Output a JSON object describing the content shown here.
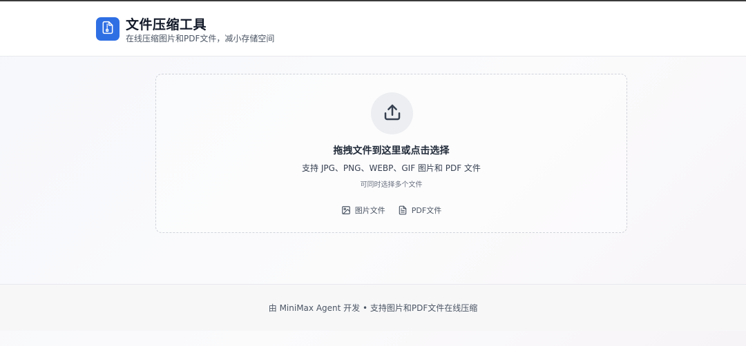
{
  "header": {
    "title": "文件压缩工具",
    "subtitle": "在线压缩图片和PDF文件，减小存储空间",
    "logo_icon": "file-archive-icon",
    "accent_color": "#2f6fe4"
  },
  "dropzone": {
    "icon": "upload-icon",
    "title": "拖拽文件到这里或点击选择",
    "description": "支持 JPG、PNG、WEBP、GIF 图片和 PDF 文件",
    "hint": "可同时选择多个文件",
    "types": [
      {
        "icon": "image-icon",
        "label": "图片文件"
      },
      {
        "icon": "document-icon",
        "label": "PDF文件"
      }
    ]
  },
  "footer": {
    "text": "由 MiniMax Agent 开发 • 支持图片和PDF文件在线压缩"
  }
}
